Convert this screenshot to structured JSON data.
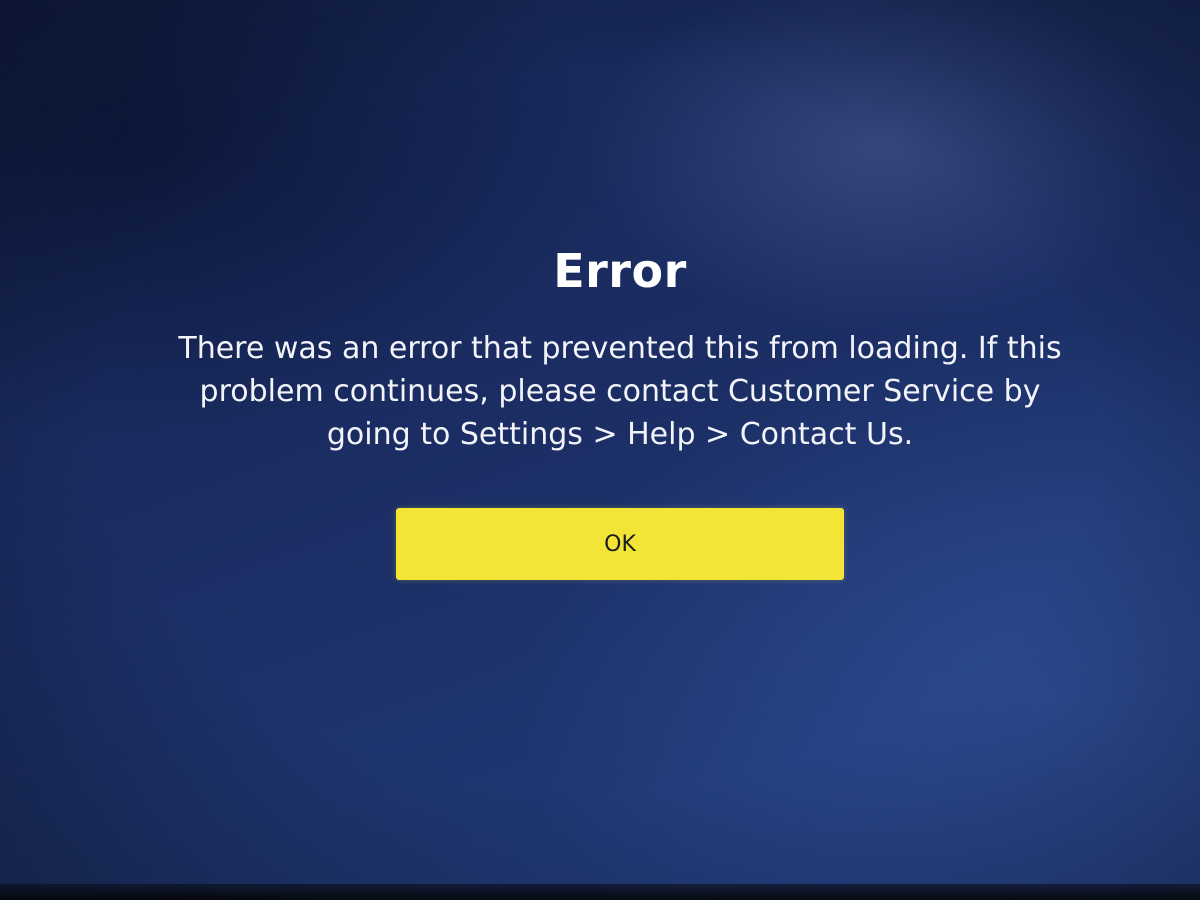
{
  "dialog": {
    "title": "Error",
    "message": "There was an error that prevented this from loading. If this problem continues, please contact Customer Service by going to Settings > Help > Contact Us.",
    "ok_label": "OK"
  },
  "colors": {
    "background": "#1b2d63",
    "button_background": "#f2e535",
    "button_text": "#1c1c1c",
    "text": "#ffffff"
  }
}
